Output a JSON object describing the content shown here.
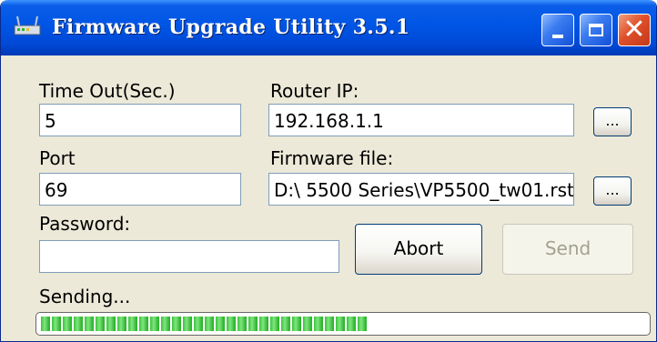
{
  "window": {
    "title": "Firmware Upgrade Utility 3.5.1",
    "app_icon": "router-app-icon",
    "minimize_icon": "minimize-icon",
    "maximize_icon": "maximize-icon",
    "close_icon": "close-icon",
    "close_glyph": "✕"
  },
  "form": {
    "timeout_label": "Time Out(Sec.)",
    "timeout_value": "5",
    "router_ip_label": "Router IP:",
    "router_ip_value": "192.168.1.1",
    "port_label": "Port",
    "port_value": "69",
    "firmware_label": "Firmware file:",
    "firmware_value": "D:\\ 5500 Series\\VP5500_tw01.rst",
    "password_label": "Password:",
    "password_value": "",
    "browse_label": "...",
    "abort_label": "Abort",
    "send_label": "Send"
  },
  "status": {
    "text": "Sending...",
    "progress": 0.54
  },
  "colors": {
    "titlebar": "#0055e5",
    "window_bg": "#ece9d8",
    "progress_green": "#3cc23c",
    "close_red": "#e0502a"
  }
}
